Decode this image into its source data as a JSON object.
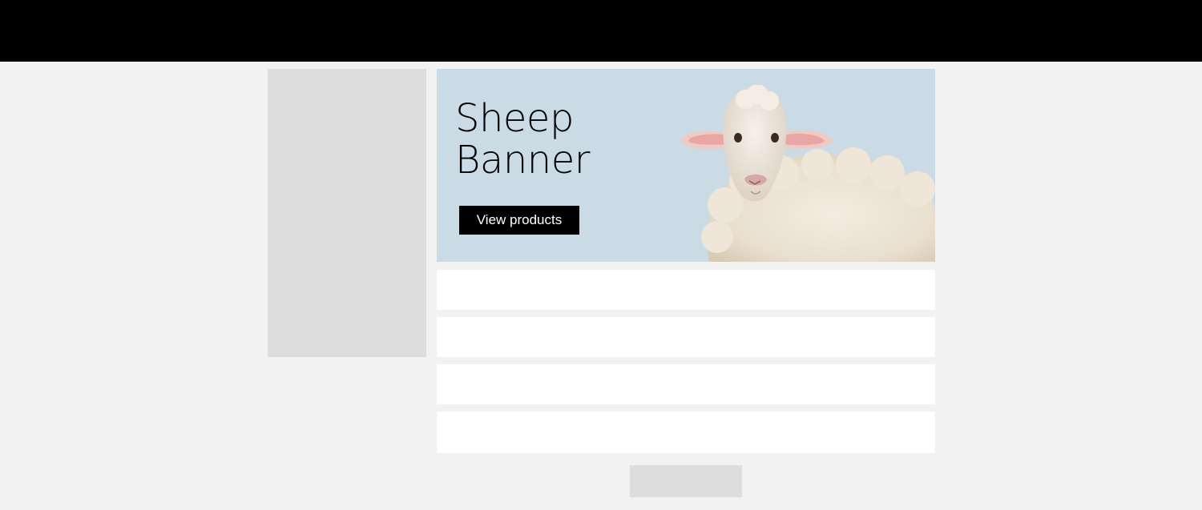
{
  "banner": {
    "title_line1": "Sheep",
    "title_line2": "Banner",
    "button_label": "View products",
    "background_color": "#cbdbe5",
    "image": "sheep-photo"
  },
  "colors": {
    "topbar": "#000000",
    "page_background": "#f2f2f2",
    "placeholder": "#dddddd",
    "row_background": "#ffffff",
    "button": "#000000"
  },
  "list": {
    "row_count": 4
  }
}
